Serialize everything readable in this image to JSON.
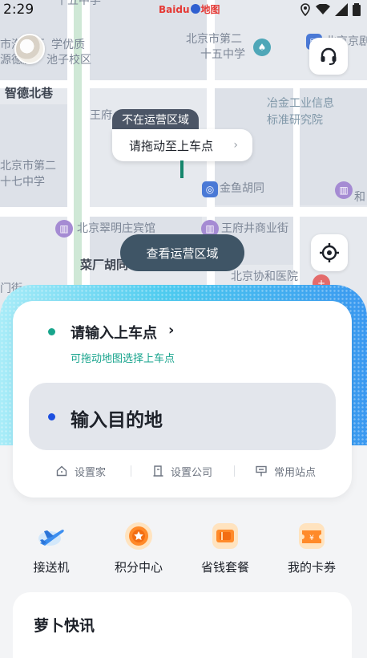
{
  "status_bar": {
    "time": "2:29"
  },
  "map": {
    "brand": "Baidu",
    "brand_suffix": "地图",
    "labels": [
      "十五中学",
      "市海淀区",
      "学优质",
      "源德胜",
      "池子校区",
      "北京市第二",
      "十五中学",
      "北京京剧",
      "智德北巷",
      "王府",
      "冶金工业信息",
      "标准研究院",
      "北京市第二",
      "十七中学",
      "金鱼胡同",
      "北京翠明庄宾馆",
      "王府井商业街",
      "菜厂胡同",
      "北京协和医院",
      "和",
      "门街"
    ],
    "out_of_area_tag": "不在运营区域",
    "drag_hint": "请拖动至上车点",
    "view_area_button": "查看运营区域"
  },
  "booking": {
    "pickup_title": "请输入上车点",
    "pickup_subtitle": "可拖动地图选择上车点",
    "destination_placeholder": "输入目的地",
    "quick_links": [
      {
        "label": "设置家",
        "icon": "home-icon"
      },
      {
        "label": "设置公司",
        "icon": "office-icon"
      },
      {
        "label": "常用站点",
        "icon": "station-icon"
      }
    ]
  },
  "services": [
    {
      "label": "接送机",
      "icon": "airplane-icon"
    },
    {
      "label": "积分中心",
      "icon": "points-icon"
    },
    {
      "label": "省钱套餐",
      "icon": "package-icon"
    },
    {
      "label": "我的卡券",
      "icon": "coupon-icon"
    }
  ],
  "news": {
    "title": "萝卜快讯"
  },
  "colors": {
    "accent_teal": "#18a58c",
    "accent_blue": "#1c4fe0",
    "panel_gradient_start": "#a8ecf8",
    "panel_gradient_end": "#3a98f0"
  }
}
